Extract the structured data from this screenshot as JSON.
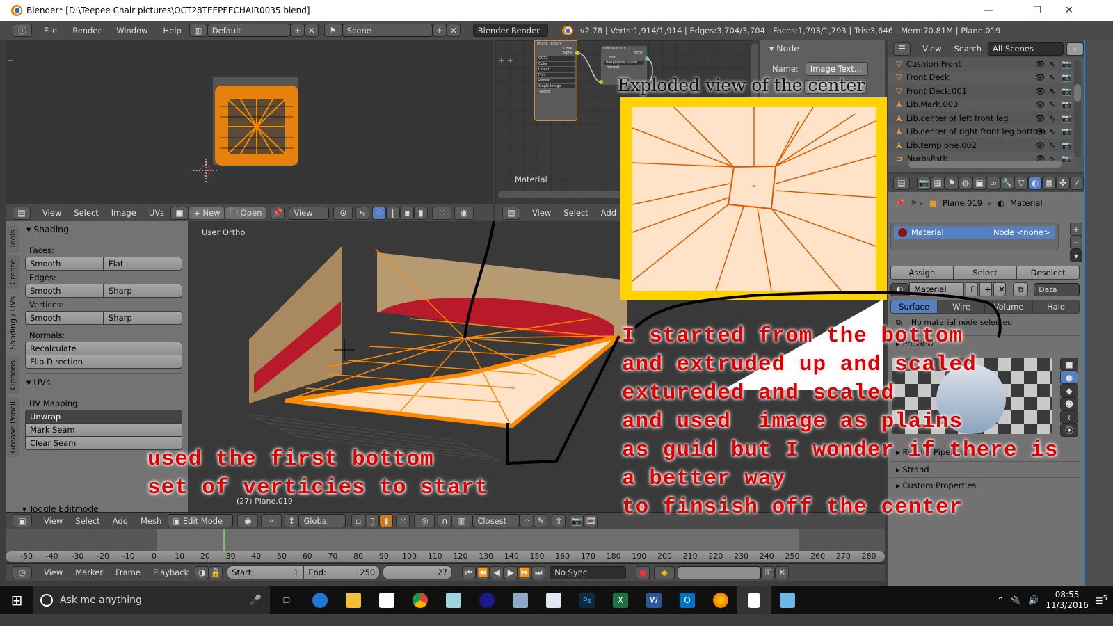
{
  "window": {
    "title": "Blender* [D:\\Teepee Chair pictures\\OCT28TEEPEECHAIR0035.blend]",
    "controls": {
      "minimize": "—",
      "maximize": "☐",
      "close": "✕"
    }
  },
  "infobar": {
    "menus": [
      "File",
      "Render",
      "Window",
      "Help"
    ],
    "layout": "Default",
    "scene": "Scene",
    "engine": "Blender Render",
    "stats": "v2.78 | Verts:1,914/1,914 | Edges:3,704/3,704 | Faces:1,793/1,793 | Tris:3,646 | Mem:70.81M | Plane.019"
  },
  "image_editor": {
    "menus": [
      "View",
      "Select",
      "Image",
      "UVs"
    ],
    "new_label": "New",
    "open_label": "Open",
    "view_label": "View"
  },
  "node_editor": {
    "label": "Material",
    "menus": [
      "View",
      "Select",
      "Add"
    ],
    "image_texture_node": {
      "title": "Image Texture",
      "outputs": [
        "Color",
        "Alpha"
      ],
      "image": "OCT2",
      "fields": [
        "Color",
        "Linear",
        "Flat",
        "Repeat",
        "Single Image"
      ],
      "input": "Vector"
    },
    "diffuse_node": {
      "title": "Diffuse BSDF",
      "output": "BSDF",
      "inputs": [
        "Color",
        "Roughness: 0.000",
        "Normal"
      ]
    },
    "sidebar": {
      "panel_title": "Node",
      "name_label": "Name:",
      "name_value": "Image Text..."
    }
  },
  "outliner": {
    "menus": [
      "View",
      "Search"
    ],
    "filter": "All Scenes",
    "items": [
      {
        "name": "Cushion Front",
        "type": "mesh"
      },
      {
        "name": "Front Deck",
        "type": "mesh"
      },
      {
        "name": "Front Deck.001",
        "type": "mesh"
      },
      {
        "name": "Lib.Mark.003",
        "type": "empty"
      },
      {
        "name": "Lib.center of left front leg",
        "type": "empty"
      },
      {
        "name": "Lib.center of right front leg bottom",
        "type": "empty"
      },
      {
        "name": "Lib.temp one.002",
        "type": "empty"
      },
      {
        "name": "NurbsPath",
        "type": "curve"
      }
    ]
  },
  "properties": {
    "breadcrumb": [
      "Plane.019",
      "Material"
    ],
    "slot": {
      "name": "Material",
      "node": "Node <none>"
    },
    "assign": "Assign",
    "select": "Select",
    "deselect": "Deselect",
    "material_name": "Material",
    "fake_user": "F",
    "data_label": "Data",
    "tabs": [
      "Surface",
      "Wire",
      "Volume",
      "Halo"
    ],
    "active_tab": "Surface",
    "no_node": "No material node selected",
    "preview_label": "Preview",
    "render_label": "Render Pipeline Options",
    "strand": "Strand",
    "custom_props": "Custom Properties"
  },
  "toolshelf": {
    "tabs": [
      "Tools",
      "Create",
      "Shading / UVs",
      "Options",
      "Grease Pencil"
    ],
    "active_tab": "Shading / UVs",
    "shading_title": "Shading",
    "faces_label": "Faces:",
    "faces": [
      "Smooth",
      "Flat"
    ],
    "edges_label": "Edges:",
    "edges": [
      "Smooth",
      "Sharp"
    ],
    "vertices_label": "Vertices:",
    "vertices": [
      "Smooth",
      "Sharp"
    ],
    "normals_label": "Normals:",
    "recalculate": "Recalculate",
    "flip": "Flip Direction",
    "uvs_title": "UVs",
    "uv_mapping_label": "UV Mapping:",
    "unwrap": "Unwrap",
    "mark_seam": "Mark Seam",
    "clear_seam": "Clear Seam",
    "toggle_editmode": "Toggle Editmode"
  },
  "viewport": {
    "view_name": "User Ortho",
    "object_label": "(27) Plane.019",
    "menus": [
      "View",
      "Select",
      "Add",
      "Mesh"
    ],
    "mode": "Edit Mode",
    "orientation": "Global",
    "snap": "Closest"
  },
  "timeline": {
    "ticks": [
      -50,
      -40,
      -30,
      -20,
      -10,
      0,
      10,
      20,
      30,
      40,
      50,
      60,
      70,
      80,
      90,
      100,
      110,
      120,
      130,
      140,
      150,
      160,
      170,
      180,
      190,
      200,
      210,
      220,
      230,
      240,
      250,
      260,
      270,
      280
    ],
    "current_frame": 27,
    "menus": [
      "View",
      "Marker",
      "Frame",
      "Playback"
    ],
    "start_label": "Start:",
    "start": "1",
    "end_label": "End:",
    "end": "250",
    "frame": "27",
    "sync": "No Sync"
  },
  "annotations": {
    "exploded_title": "Exploded view of the center",
    "left_note": "used the first bottom\nset of verticies to start",
    "right_note": "I started from the bottom\nand extruded up and scaled\nextureded and scaled\nand used  image as plains\nas guid but I wonder if there is\na better way\nto finsish off the center"
  },
  "taskbar": {
    "search_placeholder": "Ask me anything",
    "time": "08:55",
    "date": "11/3/2016",
    "notifications": "5"
  }
}
